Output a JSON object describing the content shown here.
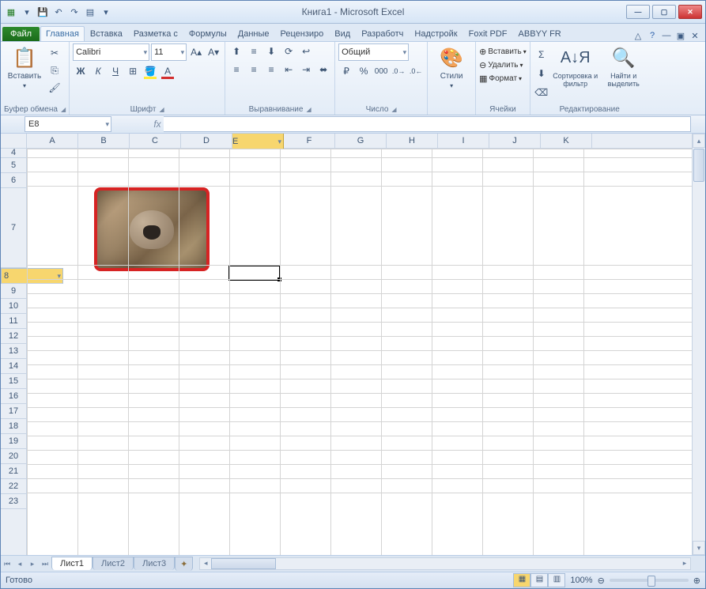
{
  "title": "Книга1 - Microsoft Excel",
  "tabs": {
    "file": "Файл",
    "home": "Главная",
    "insert": "Вставка",
    "layout": "Разметка с",
    "formulas": "Формулы",
    "data": "Данные",
    "review": "Рецензиро",
    "view": "Вид",
    "dev": "Разработч",
    "addins": "Надстройк",
    "foxit": "Foxit PDF",
    "abbyy": "ABBYY FR"
  },
  "groups": {
    "clipboard": "Буфер обмена",
    "font": "Шрифт",
    "align": "Выравнивание",
    "number": "Число",
    "styles": "Стили",
    "cells": "Ячейки",
    "editing": "Редактирование"
  },
  "clipboard": {
    "paste": "Вставить"
  },
  "font": {
    "name": "Calibri",
    "size": "11"
  },
  "number": {
    "format": "Общий"
  },
  "cellsbtn": {
    "insert": "Вставить",
    "delete": "Удалить",
    "format": "Формат"
  },
  "editing": {
    "sort": "Сортировка и фильтр",
    "find": "Найти и выделить"
  },
  "namebox": "E8",
  "cols": [
    "A",
    "B",
    "C",
    "D",
    "E",
    "F",
    "G",
    "H",
    "I",
    "J",
    "K"
  ],
  "rows": [
    "4",
    "5",
    "6",
    "7",
    "8",
    "9",
    "10",
    "11",
    "12",
    "13",
    "14",
    "15",
    "16",
    "17",
    "18",
    "19",
    "20",
    "21",
    "22",
    "23"
  ],
  "sel_col": "E",
  "sel_row": "8",
  "sel_row_idx": 4,
  "sheets": {
    "s1": "Лист1",
    "s2": "Лист2",
    "s3": "Лист3"
  },
  "status": "Готово",
  "zoom": "100%"
}
